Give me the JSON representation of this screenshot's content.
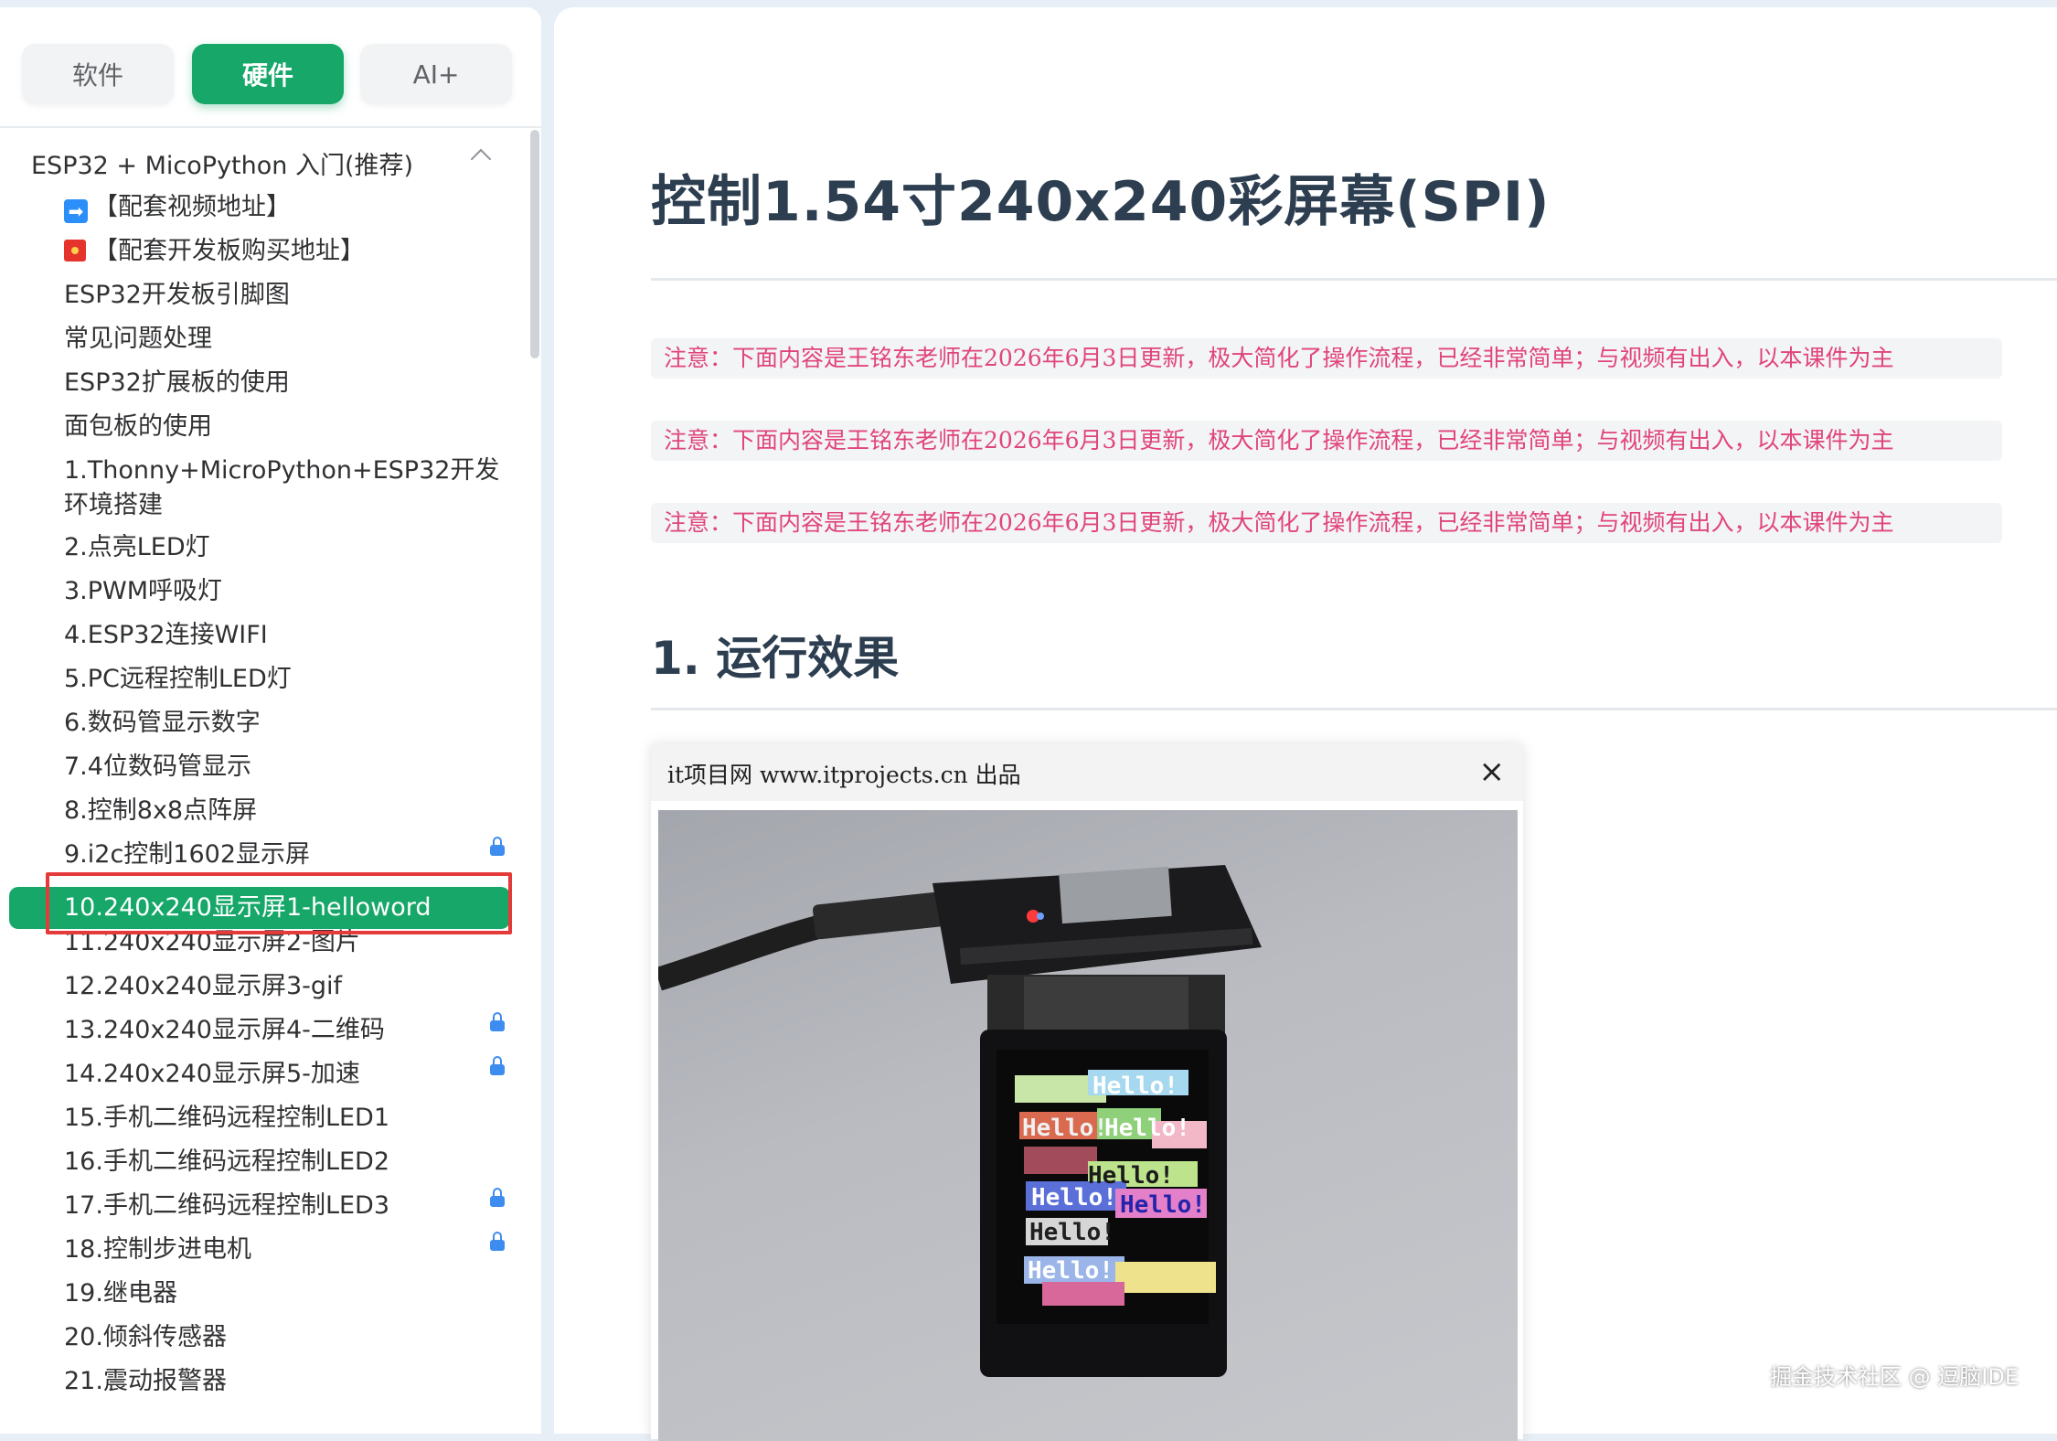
{
  "tabs": [
    "软件",
    "硬件",
    "AI+"
  ],
  "sidebar": {
    "section_title": "ESP32 + MicoPython 入门(推荐)",
    "items": [
      {
        "label": "【配套视频地址】",
        "icon": "arrow-right-icon"
      },
      {
        "label": "【配套开发板购买地址】",
        "icon": "shop-icon"
      },
      {
        "label": "ESP32开发板引脚图"
      },
      {
        "label": "常见问题处理"
      },
      {
        "label": "ESP32扩展板的使用"
      },
      {
        "label": "面包板的使用"
      },
      {
        "label": "1.Thonny+MicroPython+ESP32开发环境搭建"
      },
      {
        "label": "2.点亮LED灯"
      },
      {
        "label": "3.PWM呼吸灯"
      },
      {
        "label": "4.ESP32连接WIFI"
      },
      {
        "label": "5.PC远程控制LED灯"
      },
      {
        "label": "6.数码管显示数字"
      },
      {
        "label": "7.4位数码管显示"
      },
      {
        "label": "8.控制8x8点阵屏"
      },
      {
        "label": "9.i2c控制1602显示屏",
        "locked": true
      },
      {
        "label": "10.240x240显示屏1-helloword",
        "active": true
      },
      {
        "label": "11.240x240显示屏2-图片"
      },
      {
        "label": "12.240x240显示屏3-gif"
      },
      {
        "label": "13.240x240显示屏4-二维码",
        "locked": true
      },
      {
        "label": "14.240x240显示屏5-加速",
        "locked": true
      },
      {
        "label": "15.手机二维码远程控制LED1"
      },
      {
        "label": "16.手机二维码远程控制LED2"
      },
      {
        "label": "17.手机二维码远程控制LED3",
        "locked": true
      },
      {
        "label": "18.控制步进电机",
        "locked": true
      },
      {
        "label": "19.继电器"
      },
      {
        "label": "20.倾斜传感器"
      },
      {
        "label": "21.震动报警器"
      }
    ]
  },
  "main": {
    "title": "控制1.54寸240x240彩屏幕(SPI)",
    "notices": [
      "注意：下面内容是王铭东老师在2026年6月3日更新，极大简化了操作流程，已经非常简单；与视频有出入，以本课件为主",
      "注意：下面内容是王铭东老师在2026年6月3日更新，极大简化了操作流程，已经非常简单；与视频有出入，以本课件为主",
      "注意：下面内容是王铭东老师在2026年6月3日更新，极大简化了操作流程，已经非常简单；与视频有出入，以本课件为主"
    ],
    "section_heading": "1. 运行效果",
    "image_window": {
      "title": "it项目网 www.itprojects.cn 出品",
      "close": "×"
    },
    "screen_text": "Hello!"
  },
  "watermark": "掘金技术社区 @ 逗脑IDE",
  "colors": {
    "accent": "#16a769",
    "notice": "#e0457b",
    "lock": "#3d8cf0",
    "highlight": "#e43a3a"
  }
}
